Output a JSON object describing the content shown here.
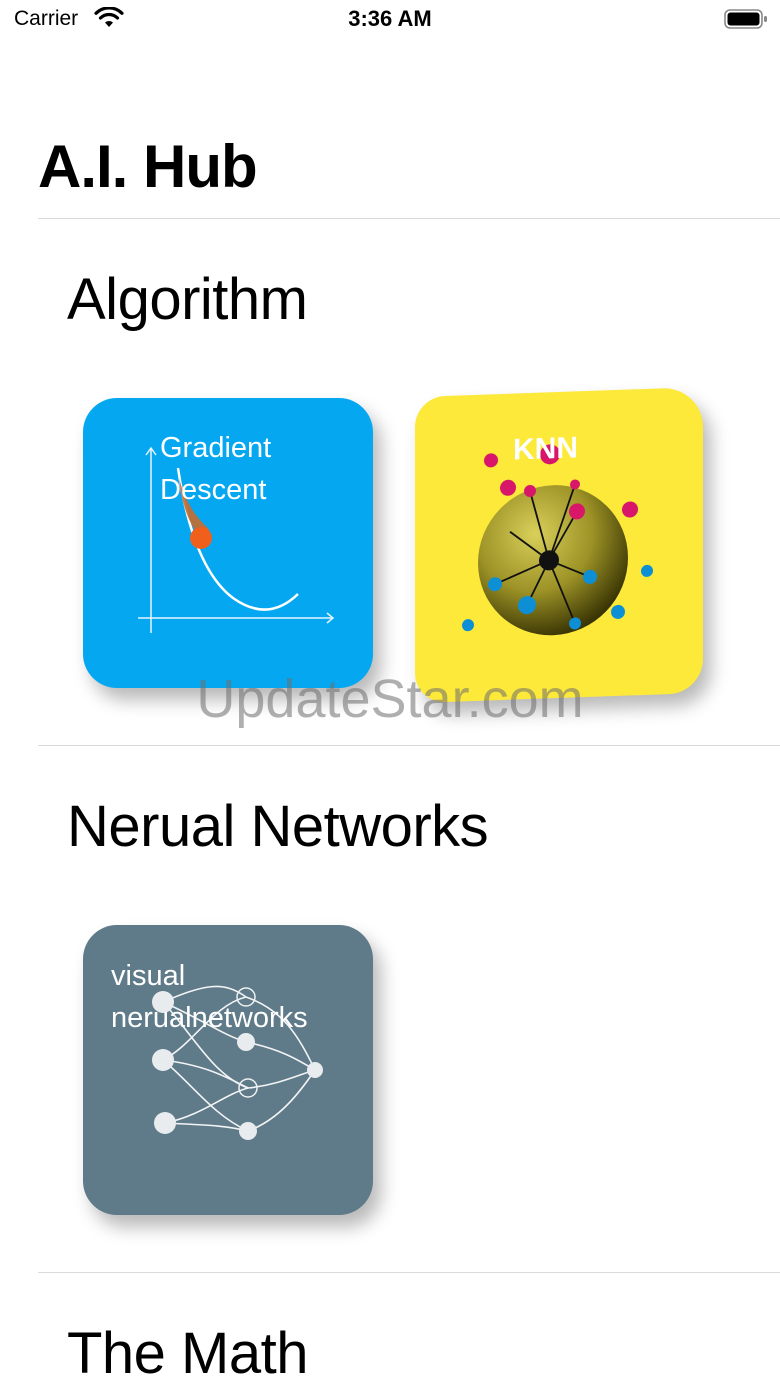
{
  "status_bar": {
    "carrier": "Carrier",
    "time": "3:36 AM",
    "wifi_icon": "wifi-icon",
    "battery_icon": "battery-full-icon"
  },
  "page": {
    "title": "A.I. Hub"
  },
  "sections": [
    {
      "title": "Algorithm",
      "cards": [
        {
          "label": "Gradient\nDescent",
          "bg": "#05a8f0",
          "icon": "gradient-descent-chart-icon"
        },
        {
          "label": "KNN",
          "bg": "#fde93a",
          "icon": "knn-sphere-icon"
        }
      ]
    },
    {
      "title": "Nerual Networks",
      "cards": [
        {
          "label": "visual\nnerualnetworks",
          "bg": "#5f7a88",
          "icon": "neural-network-icon"
        }
      ]
    },
    {
      "title": "The Math",
      "cards": []
    }
  ],
  "watermark": "UpdateStar.com",
  "colors": {
    "divider": "#d9d9de",
    "accent_orange": "#f0601c",
    "knn_magenta": "#d8176a",
    "knn_blue": "#0d8fd6"
  }
}
